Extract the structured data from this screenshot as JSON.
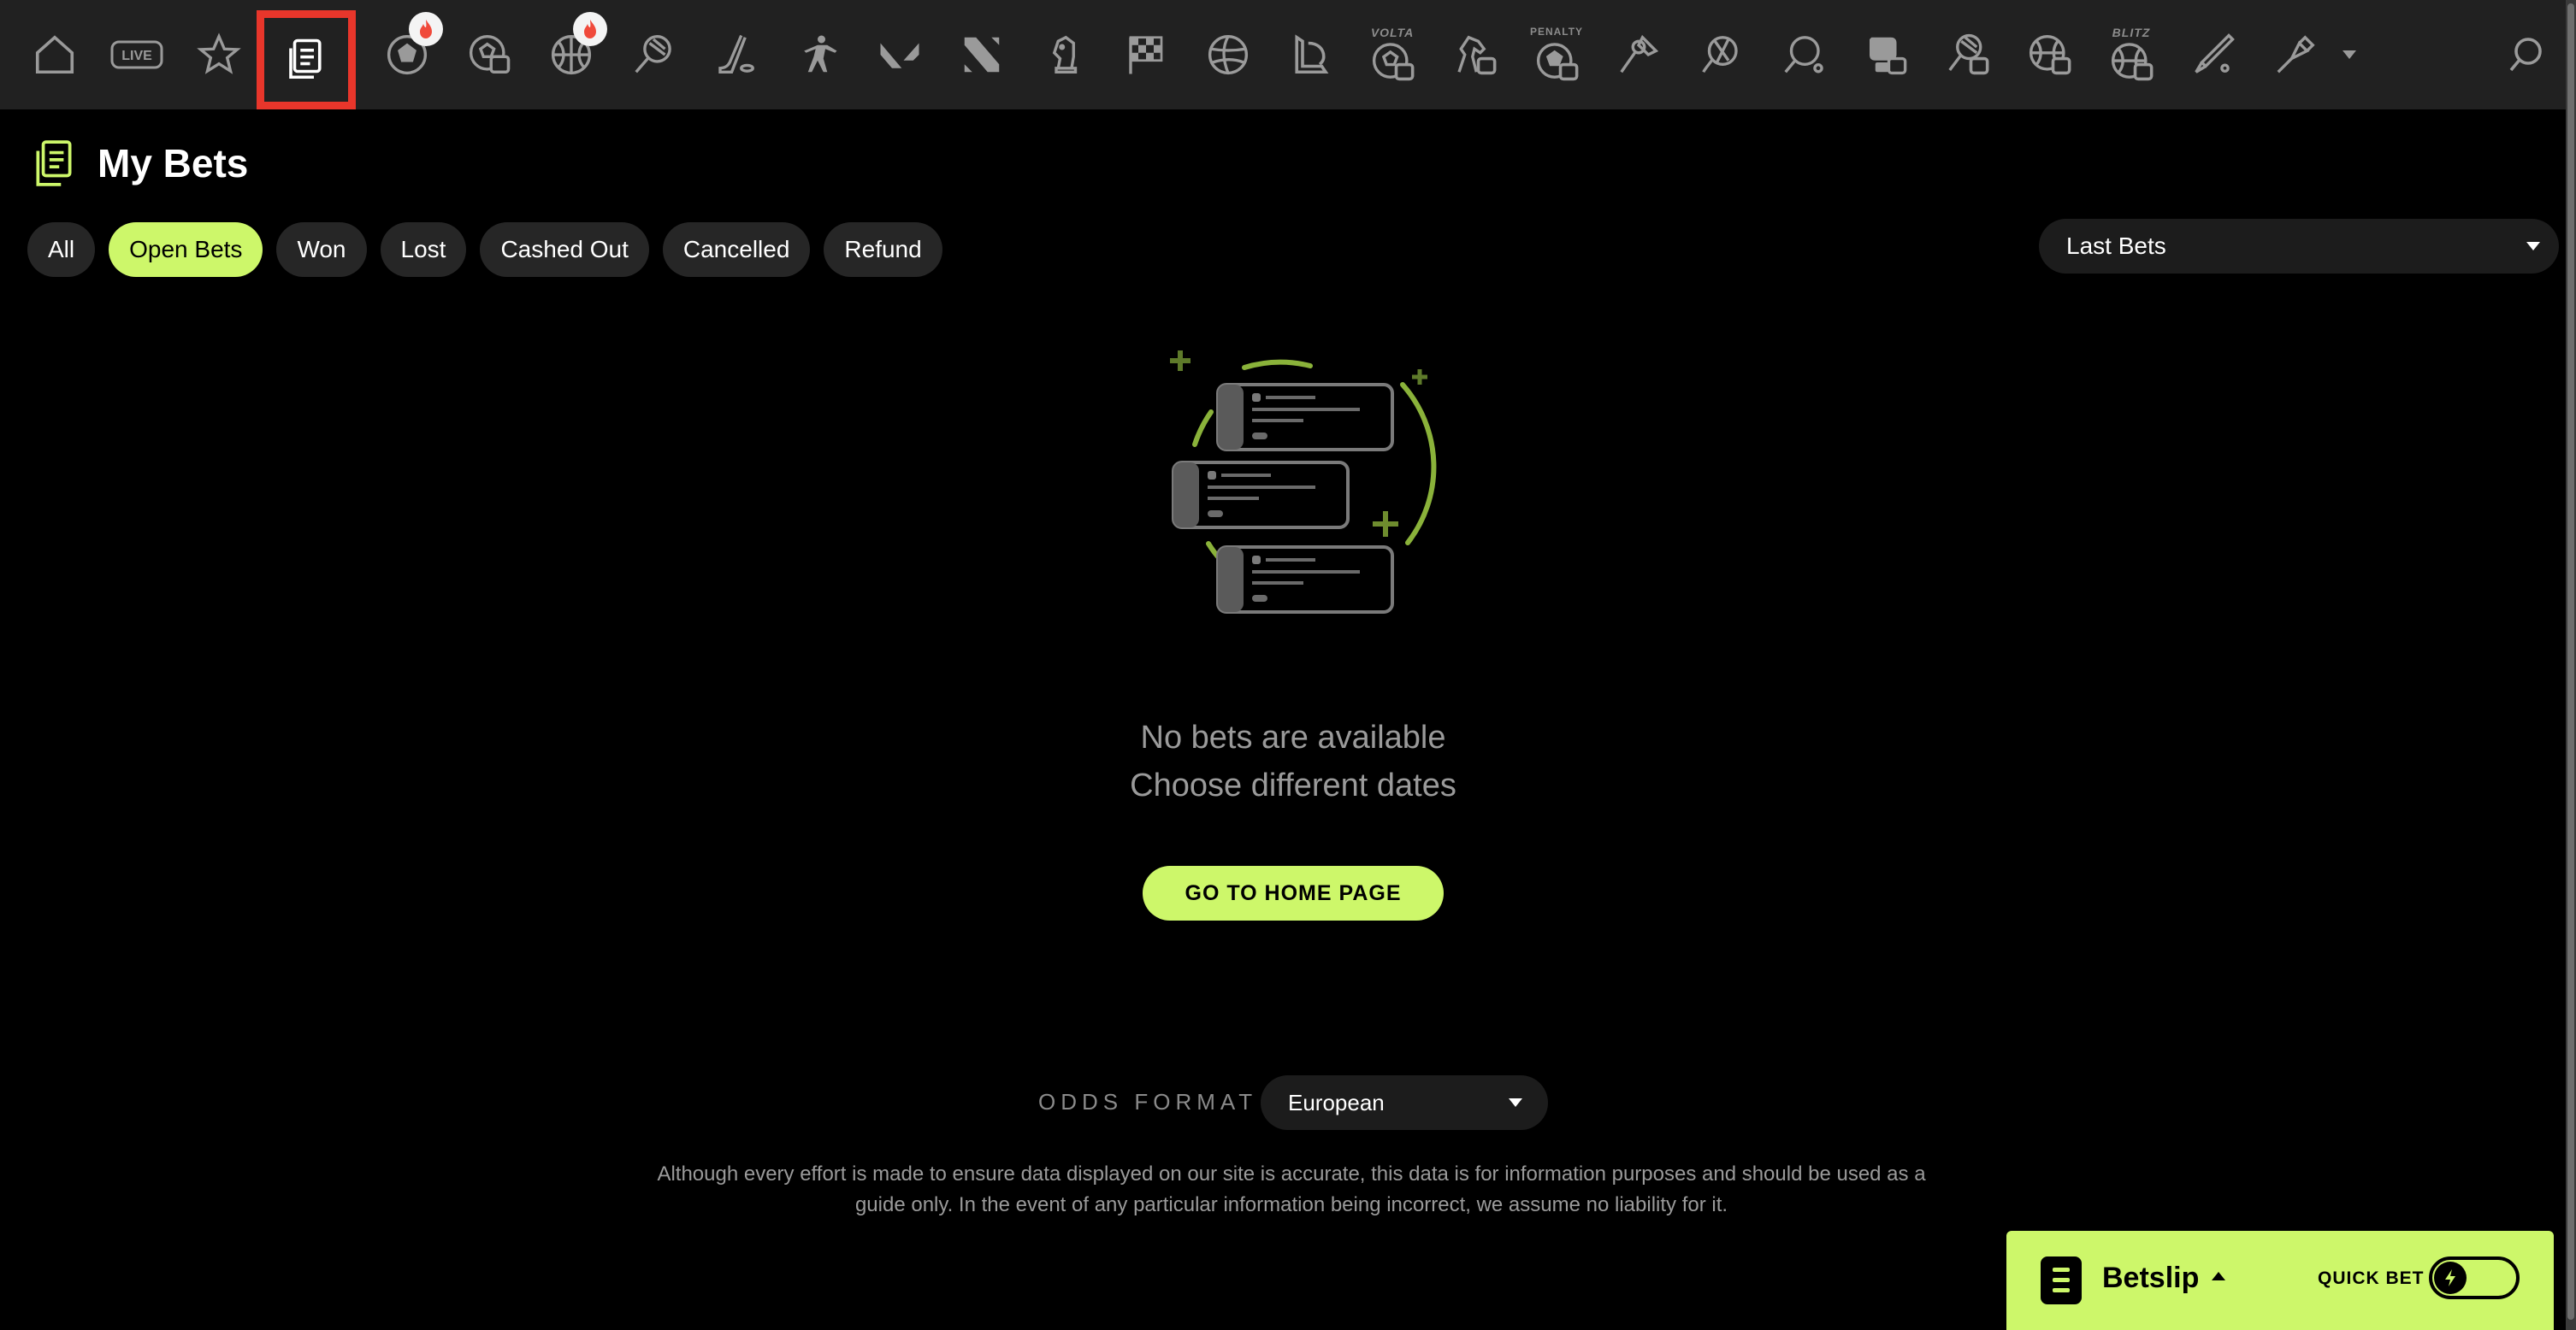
{
  "nav": {
    "items": [
      {
        "name": "home-icon"
      },
      {
        "name": "live-icon",
        "label": "LIVE"
      },
      {
        "name": "favorites-star-icon"
      },
      {
        "name": "my-bets-icon",
        "active": true
      },
      {
        "name": "soccer-icon",
        "hot": true
      },
      {
        "name": "virtual-soccer-icon"
      },
      {
        "name": "basketball-icon",
        "hot": true
      },
      {
        "name": "tennis-icon"
      },
      {
        "name": "ice-hockey-icon"
      },
      {
        "name": "counter-strike-icon"
      },
      {
        "name": "valorant-icon"
      },
      {
        "name": "dota-icon"
      },
      {
        "name": "chess-icon"
      },
      {
        "name": "motorsport-flag-icon"
      },
      {
        "name": "volleyball-icon"
      },
      {
        "name": "league-of-legends-icon"
      },
      {
        "name": "volta-icon",
        "label": "VOLTA"
      },
      {
        "name": "virtual-horse-racing-icon"
      },
      {
        "name": "penalty-icon",
        "label": "PENALTY"
      },
      {
        "name": "badminton-icon"
      },
      {
        "name": "handball-icon"
      },
      {
        "name": "table-tennis-icon"
      },
      {
        "name": "virtual-boxing-icon"
      },
      {
        "name": "virtual-tennis-icon"
      },
      {
        "name": "virtual-basketball-icon"
      },
      {
        "name": "blitz-icon",
        "label": "BLITZ"
      },
      {
        "name": "cricket-icon"
      },
      {
        "name": "darts-icon"
      }
    ],
    "more_icon": "chevron-down-icon",
    "search_icon": "search-icon"
  },
  "page": {
    "title": "My Bets"
  },
  "filters": [
    {
      "label": "All",
      "active": false
    },
    {
      "label": "Open Bets",
      "active": true
    },
    {
      "label": "Won",
      "active": false
    },
    {
      "label": "Lost",
      "active": false
    },
    {
      "label": "Cashed Out",
      "active": false
    },
    {
      "label": "Cancelled",
      "active": false
    },
    {
      "label": "Refund",
      "active": false
    }
  ],
  "period": {
    "selected": "Last Bets"
  },
  "empty_state": {
    "line1": "No bets are available",
    "line2": "Choose different dates",
    "button": "GO TO HOME PAGE"
  },
  "odds": {
    "label": "ODDS FORMAT",
    "selected": "European"
  },
  "disclaimer": "Although every effort is made to ensure data displayed on our site is accurate, this data is for information purposes and should be used as a guide only. In the event of any particular information being incorrect, we assume no liability for it.",
  "betslip": {
    "title": "Betslip",
    "quick_bet_label": "QUICK BET",
    "quick_bet_on": false
  },
  "colors": {
    "accent": "#cdf76a",
    "nav_bg": "#212121",
    "page_bg": "#000000",
    "active_outline": "#e8362b",
    "hot_badge": "#f04a3b"
  }
}
